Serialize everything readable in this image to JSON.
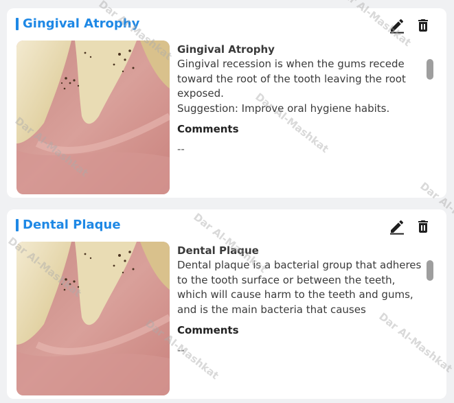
{
  "cards": [
    {
      "title": "Gingival Atrophy",
      "description_title": "Gingival Atrophy",
      "description_text": "Gingival recession is when the gums recede toward the root of the tooth leaving the root exposed.\nSuggestion: Improve oral hygiene habits.",
      "comments_label": "Comments",
      "comments_value": "--"
    },
    {
      "title": "Dental Plaque",
      "description_title": "Dental Plaque",
      "description_text": "Dental plaque is a bacterial group that adheres to the tooth surface or between the teeth, which will cause harm to the teeth and gums, and is the main bacteria that causes",
      "comments_label": "Comments",
      "comments_value": "--"
    }
  ],
  "watermark_text": "Dar Al-Mashkat",
  "colors": {
    "accent": "#1e88e5",
    "title_bar": "#1e88e5",
    "icon": "#1f1f1f"
  },
  "icons": {
    "edit": "pencil-icon",
    "delete": "trash-icon"
  }
}
